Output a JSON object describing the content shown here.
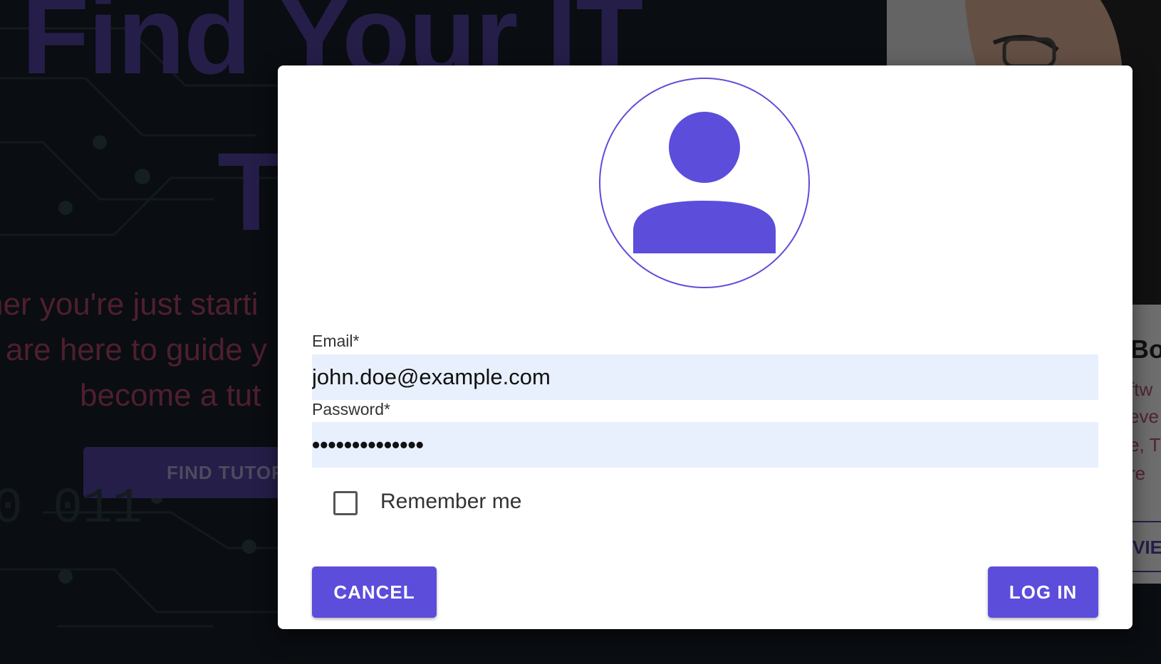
{
  "background": {
    "hero_line1": "Find Your IT",
    "hero_line2": "T",
    "subtitle_line1": "her you're just starti",
    "subtitle_line2": "are here to guide y",
    "subtitle_line3": "become a tut",
    "find_button": "FIND TUTOR",
    "binary_text": "0  011",
    "card": {
      "name": "Bo",
      "text_line1": "ftw",
      "text_line2": "eve",
      "text_line3": "e, T",
      "text_line4": "re",
      "view_button": "VIE"
    }
  },
  "dialog": {
    "avatar_icon": "user-avatar-icon",
    "email": {
      "label": "Email*",
      "value": "john.doe@example.com"
    },
    "password": {
      "label": "Password*",
      "value": "••••••••••••••"
    },
    "remember_label": "Remember me",
    "remember_checked": false,
    "cancel_label": "CANCEL",
    "login_label": "LOG IN"
  },
  "colors": {
    "accent": "#5c4ddb",
    "input_background": "#e8f0fe",
    "hero_title": "#4a3d93",
    "hero_subtitle": "#9c3e5c"
  }
}
